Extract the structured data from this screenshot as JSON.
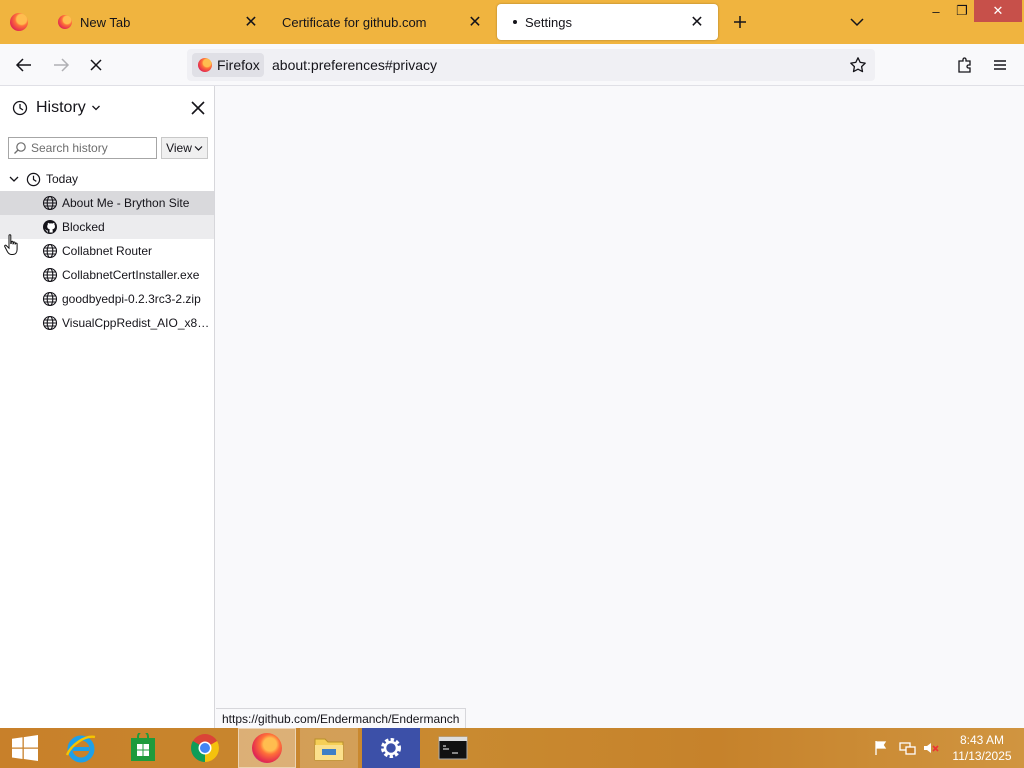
{
  "tabs": [
    {
      "title": "New Tab",
      "favicon": "firefox-icon",
      "active": false
    },
    {
      "title": "Certificate for github.com",
      "favicon": "",
      "active": false
    },
    {
      "title": "Settings",
      "favicon": "dot",
      "active": true
    }
  ],
  "tabstrip": {
    "new_tab_icon": "plus-icon",
    "list_tabs_icon": "chevron-down-icon"
  },
  "window_controls": {
    "minimize": "–",
    "restore": "❐",
    "close": "✕"
  },
  "navbar": {
    "identity_label": "Firefox",
    "url": "about:preferences#privacy",
    "back_icon": "arrow-left-icon",
    "forward_icon": "arrow-right-icon",
    "stop_icon": "close-icon",
    "bookmark_icon": "star-icon",
    "extensions_icon": "puzzle-icon",
    "menu_icon": "hamburger-icon"
  },
  "sidebar": {
    "title": "History",
    "search_placeholder": "Search history",
    "view_label": "View",
    "group": {
      "label": "Today",
      "expanded": true
    },
    "items": [
      {
        "label": "About Me - Brython Site",
        "icon": "globe-icon",
        "state": "selected"
      },
      {
        "label": "Blocked",
        "icon": "github-icon",
        "state": "hovered"
      },
      {
        "label": "Collabnet Router",
        "icon": "globe-icon",
        "state": ""
      },
      {
        "label": "CollabnetCertInstaller.exe",
        "icon": "globe-icon",
        "state": ""
      },
      {
        "label": "goodbyedpi-0.2.3rc3-2.zip",
        "icon": "globe-icon",
        "state": ""
      },
      {
        "label": "VisualCppRedist_AIO_x86_...",
        "icon": "globe-icon",
        "state": ""
      }
    ]
  },
  "status_url": "https://github.com/Endermanch/Endermanch",
  "taskbar": {
    "apps": [
      "windows-start-icon",
      "internet-explorer-icon",
      "store-icon",
      "chrome-icon",
      "firefox-icon",
      "file-explorer-icon",
      "settings-icon",
      "command-prompt-icon"
    ],
    "active_app": "firefox-icon",
    "tray_icons": [
      "flag-icon",
      "network-icon",
      "volume-muted-icon"
    ],
    "time": "8:43 AM",
    "date": "11/13/2025"
  },
  "colors": {
    "tabstrip": "#f0b43f",
    "taskbar": "#c8802a",
    "window_close": "#c7504a",
    "selected_row": "#d9d9dc"
  }
}
